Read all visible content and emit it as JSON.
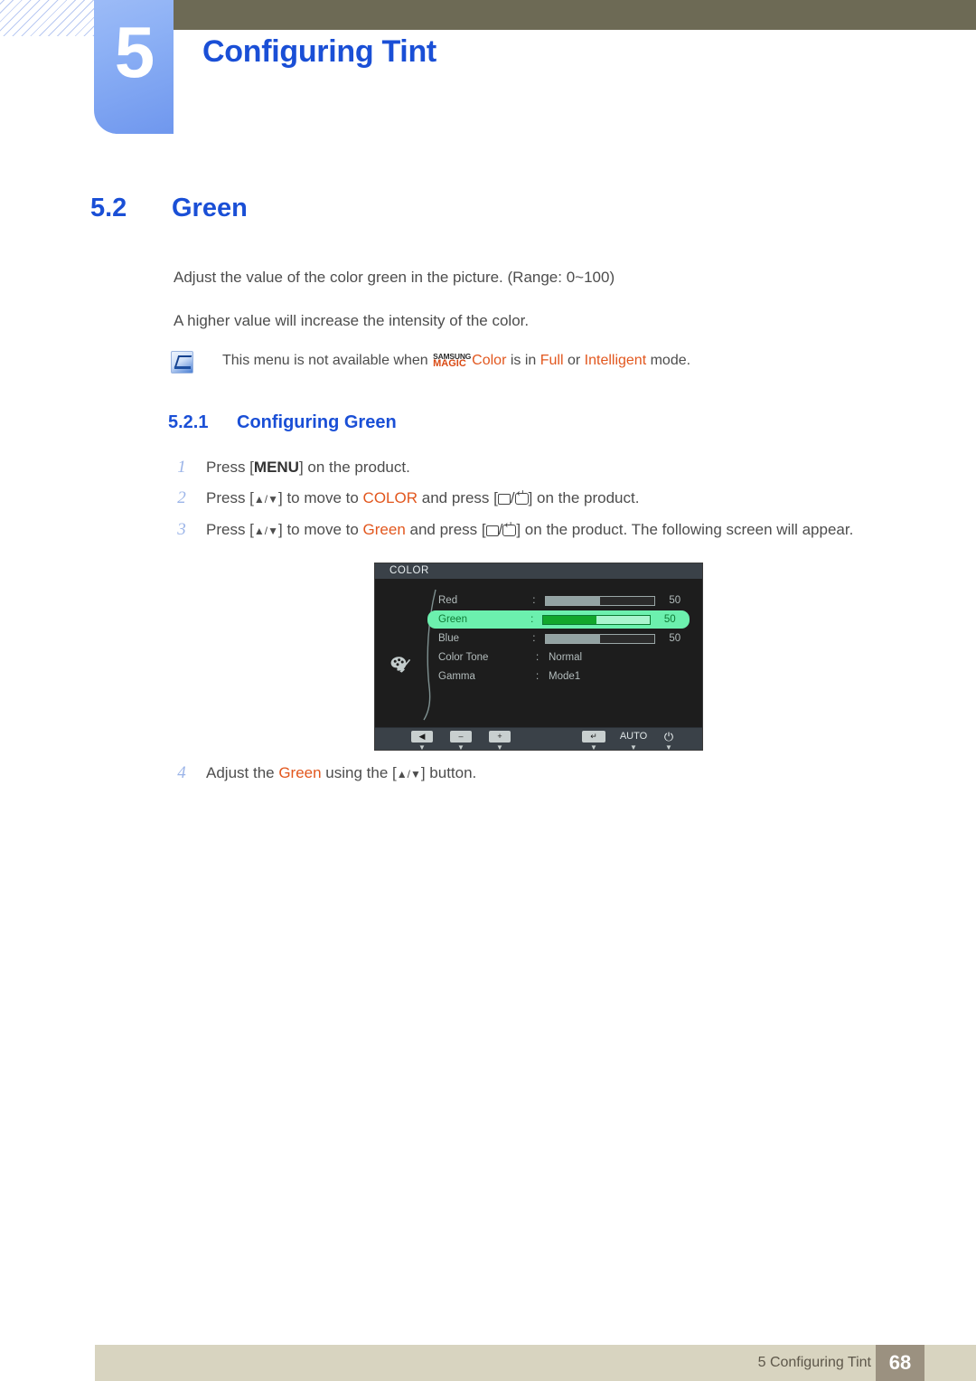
{
  "header": {
    "chapter_number": "5",
    "chapter_title": "Configuring Tint"
  },
  "section": {
    "number": "5.2",
    "title": "Green",
    "paragraph1": "Adjust the value of the color green in the picture. (Range: 0~100)",
    "paragraph2": "A higher value will increase the intensity of the color.",
    "note": {
      "icon": "note-pen-icon",
      "text_before": "This menu is not available when ",
      "logo_line1": "SAMSUNG",
      "logo_line2": "MAGIC",
      "logo_suffix": "Color",
      "text_mid": " is in ",
      "mode1": "Full",
      "text_or": " or ",
      "mode2": "Intelligent",
      "text_after": " mode."
    }
  },
  "subsection": {
    "number": "5.2.1",
    "title": "Configuring Green",
    "steps": [
      {
        "num": "1",
        "pre": "Press [",
        "key": "MENU",
        "post": "] on the product."
      },
      {
        "num": "2",
        "pre": "Press [",
        "arrows": "▲/▼",
        "mid1": "] to move to ",
        "target": "COLOR",
        "mid2": " and press [",
        "mid3": "/",
        "post": "] on the product."
      },
      {
        "num": "3",
        "pre": "Press [",
        "arrows": "▲/▼",
        "mid1": "] to move to ",
        "target": "Green",
        "mid2": " and press [",
        "mid3": "/",
        "post": "] on the product. The following screen will appear."
      }
    ],
    "step4": {
      "num": "4",
      "pre": "Adjust the ",
      "target": "Green",
      "mid": " using the [",
      "arrows": "▲/▼",
      "post": "] button."
    }
  },
  "osd": {
    "title": "COLOR",
    "palette_icon": "color-palette-icon",
    "rows": [
      {
        "label": "Red",
        "colon": ":",
        "type": "slider",
        "value": "50",
        "fill_percent": 50,
        "selected": false
      },
      {
        "label": "Green",
        "colon": ":",
        "type": "slider",
        "value": "50",
        "fill_percent": 50,
        "selected": true
      },
      {
        "label": "Blue",
        "colon": ":",
        "type": "slider",
        "value": "50",
        "fill_percent": 50,
        "selected": false
      },
      {
        "label": "Color Tone",
        "colon": ":",
        "type": "text",
        "value": "Normal",
        "selected": false
      },
      {
        "label": "Gamma",
        "colon": ":",
        "type": "text",
        "value": "Mode1",
        "selected": false
      }
    ],
    "buttons": [
      {
        "name": "back-button",
        "glyph": "◀",
        "caret": "▼"
      },
      {
        "name": "minus-button",
        "glyph": "–",
        "caret": "▼"
      },
      {
        "name": "plus-button",
        "glyph": "+",
        "caret": "▼"
      },
      {
        "name": "enter-button",
        "glyph": "↵",
        "caret": "▼"
      },
      {
        "name": "auto-button",
        "glyph": "AUTO",
        "caret": "▼"
      },
      {
        "name": "power-button",
        "glyph": "⏻",
        "caret": "▼"
      }
    ]
  },
  "footer": {
    "label": "5 Configuring Tint",
    "page_number": "68"
  },
  "colors": {
    "accent_blue": "#1a4fd6",
    "olive_bar": "#6d6a55",
    "orange": "#e2571e",
    "footer_bar": "#d8d4c0",
    "footer_page_box": "#9b9180",
    "osd_selected_green": "#6cf0ae"
  }
}
